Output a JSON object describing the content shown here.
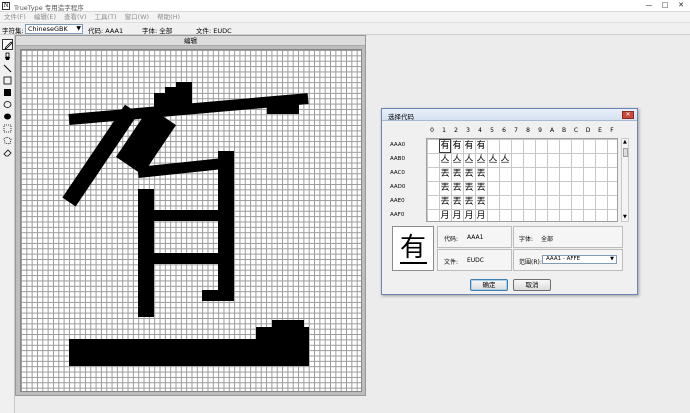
{
  "app": {
    "title": "TrueType 专用造字程序",
    "icon_name": "app-icon",
    "window_buttons": [
      "—",
      "□",
      "✕"
    ]
  },
  "menu": {
    "items": [
      "文件(F)",
      "编辑(E)",
      "查看(V)",
      "工具(T)",
      "窗口(W)",
      "帮助(H)"
    ]
  },
  "infobar": {
    "charset_label": "字符集:",
    "charset_value": "ChineseGBK",
    "code": "代码: AAA1",
    "font": "字体: 全部",
    "file": "文件: EUDC"
  },
  "toolbar": {
    "tools": [
      "pencil-icon",
      "brush-icon",
      "line-icon",
      "hollow-rect-icon",
      "filled-rect-icon",
      "hollow-ellipse-icon",
      "filled-ellipse-icon",
      "rect-select-icon",
      "freeform-select-icon",
      "eraser-icon"
    ]
  },
  "editor": {
    "title": "编辑"
  },
  "dialog": {
    "title": "选择代码",
    "close": "✕",
    "column_headers": [
      "0",
      "1",
      "2",
      "3",
      "4",
      "5",
      "6",
      "7",
      "8",
      "9",
      "A",
      "B",
      "C",
      "D",
      "E",
      "F"
    ],
    "row_headers": [
      "AAA0",
      "AAB0",
      "AAC0",
      "AAD0",
      "AAE0",
      "AAF0"
    ],
    "rows": [
      [
        "",
        "有",
        "有",
        "有",
        "有"
      ],
      [
        "",
        "亼",
        "亼",
        "亼",
        "亼",
        "亼",
        "亼"
      ],
      [
        "",
        "丟",
        "丟",
        "丟",
        "丟"
      ],
      [
        "",
        "丟",
        "丟",
        "丟",
        "丟"
      ],
      [
        "",
        "丟",
        "丟",
        "丟",
        "丟"
      ],
      [
        "",
        "月",
        "月",
        "月",
        "月"
      ]
    ],
    "preview_char": "有",
    "code_label": "代码:",
    "code_value": "AAA1",
    "font_label": "字体:",
    "font_value": "全部",
    "file_label": "文件:",
    "file_value": "EUDC",
    "range_label": "范围(R):",
    "range_value": "AAA1 - AFFE",
    "ok_label": "确定",
    "cancel_label": "取消"
  }
}
